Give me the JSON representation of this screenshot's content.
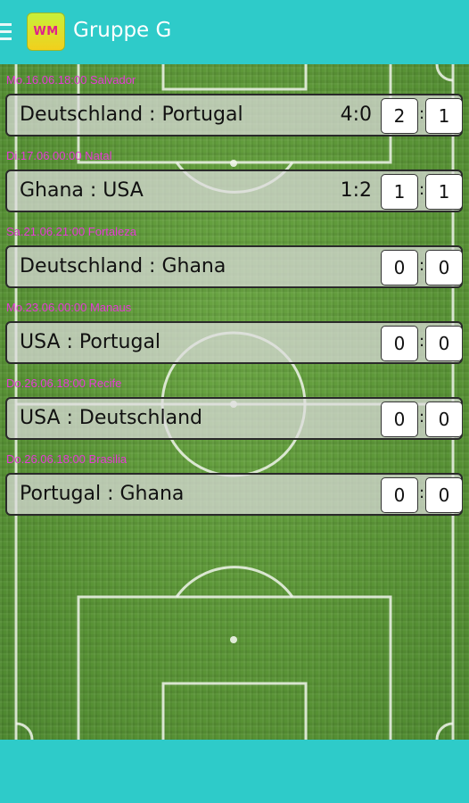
{
  "app": {
    "title": "Gruppe G",
    "logo_text": "WM",
    "accent_color": "#2ecbc9",
    "date_color": "#e63ad6"
  },
  "matches": [
    {
      "date": "Mo.16.06.18:00 Salvador",
      "teams": "Deutschland : Portugal",
      "result": "4:0",
      "home_score": "2",
      "separator": ":",
      "away_score": "1"
    },
    {
      "date": "Di.17.06.00:00 Natal",
      "teams": "Ghana : USA",
      "result": "1:2",
      "home_score": "1",
      "separator": ":",
      "away_score": "1"
    },
    {
      "date": "Sa.21.06.21:00 Fortaleza",
      "teams": "Deutschland : Ghana",
      "result": "",
      "home_score": "0",
      "separator": ":",
      "away_score": "0"
    },
    {
      "date": "Mo.23.06.00:00 Manaus",
      "teams": "USA : Portugal",
      "result": "",
      "home_score": "0",
      "separator": ":",
      "away_score": "0"
    },
    {
      "date": "Do.26.06.18:00 Recife",
      "teams": "USA : Deutschland",
      "result": "",
      "home_score": "0",
      "separator": ":",
      "away_score": "0"
    },
    {
      "date": "Do.26.06.18:00 Brasilia",
      "teams": "Portugal : Ghana",
      "result": "",
      "home_score": "0",
      "separator": ":",
      "away_score": "0"
    }
  ]
}
